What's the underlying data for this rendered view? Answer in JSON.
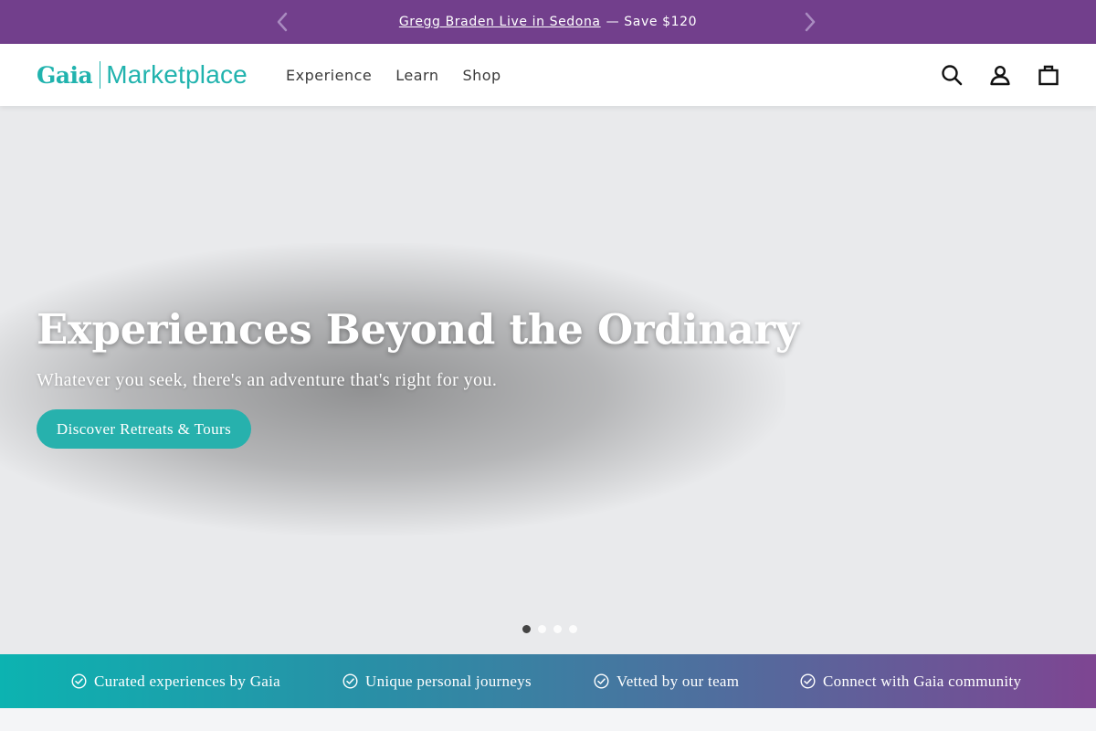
{
  "announcement": {
    "link_text": "Gregg Braden Live in Sedona",
    "suffix": "— Save $120",
    "prev_icon": "chevron-left-icon",
    "next_icon": "chevron-right-icon"
  },
  "header": {
    "logo_brand": "Gaia",
    "logo_sub": "Marketplace",
    "nav": [
      {
        "label": "Experience"
      },
      {
        "label": "Learn"
      },
      {
        "label": "Shop"
      }
    ],
    "icons": [
      "search-icon",
      "account-icon",
      "cart-icon"
    ]
  },
  "hero": {
    "title": "Experiences Beyond the Ordinary",
    "subtitle": "Whatever you seek, there's an adventure that's right for you.",
    "cta_label": "Discover Retreats & Tours",
    "slide_count": 4,
    "active_slide": 1
  },
  "features": [
    {
      "label": "Curated experiences by Gaia"
    },
    {
      "label": "Unique personal journeys"
    },
    {
      "label": "Vetted by our team"
    },
    {
      "label": "Connect with Gaia community"
    }
  ],
  "colors": {
    "announce_bg": "#723f8c",
    "accent": "#21b3ae",
    "cta_bg": "#27b1ad",
    "hero_bg": "#e9eaec",
    "strip_start": "#0cb3b1",
    "strip_end": "#7e4592"
  }
}
